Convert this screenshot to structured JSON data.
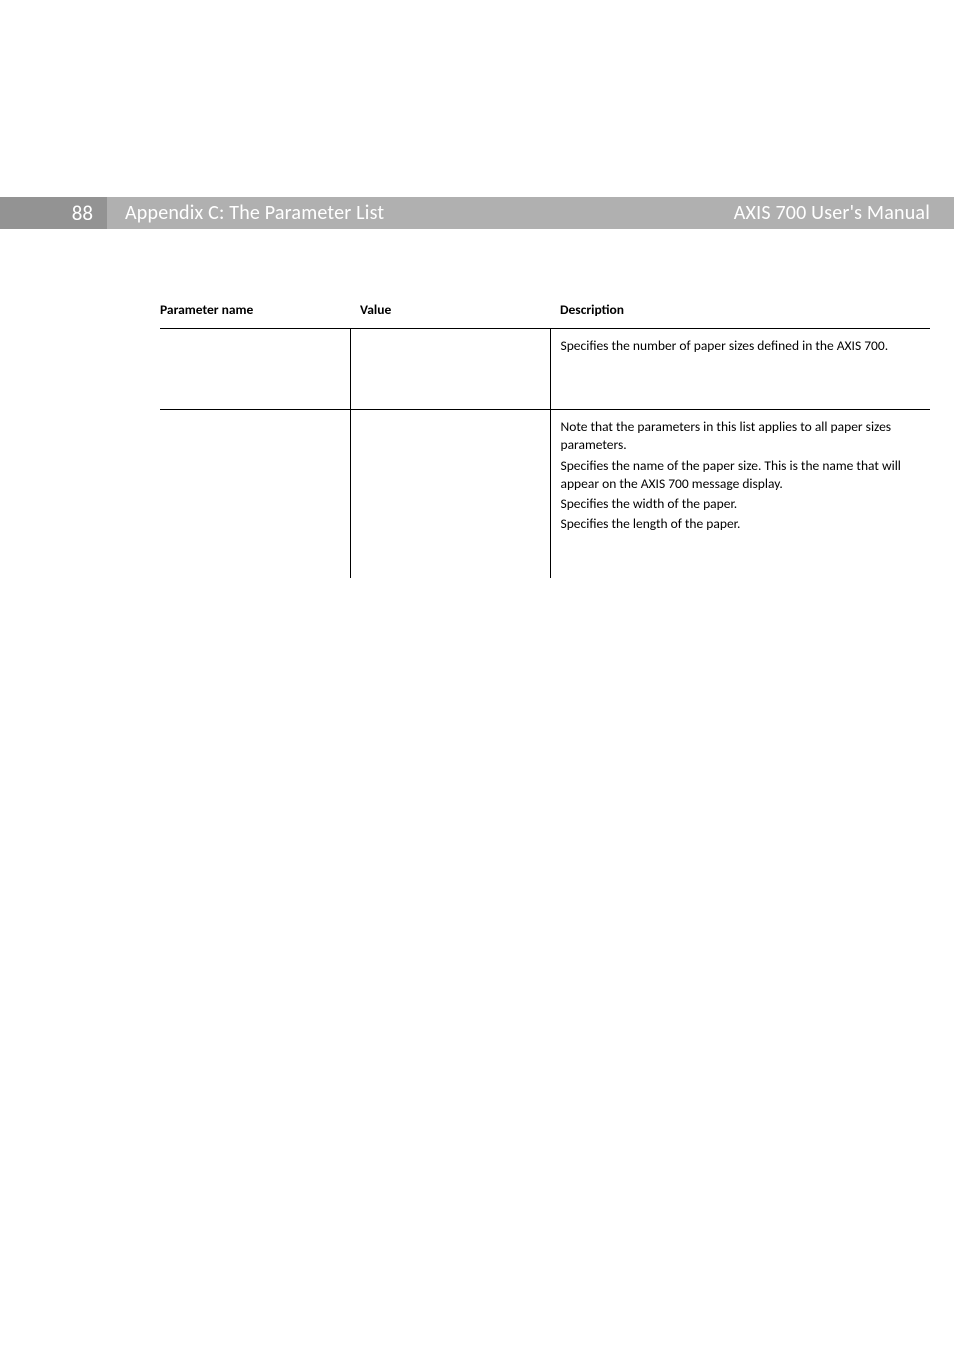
{
  "header": {
    "page_number": "88",
    "appendix_title": "Appendix C: The Parameter List",
    "manual_title": "AXIS 700 User's Manual"
  },
  "table": {
    "headers": {
      "parameter_name": "Parameter name",
      "value": "Value",
      "description": "Description"
    },
    "row1": {
      "parameter_name": "",
      "value": "",
      "description": "Specifies the number of paper sizes defined in the AXIS 700."
    },
    "row2": {
      "parameter_name": "",
      "value": "",
      "d1": "Note that the parameters in this list applies to all paper sizes parameters.",
      "d2": "Specifies the name of the paper size. This is the name that will appear on the AXIS 700 message display.",
      "d3": "Specifies the width of the paper.",
      "d4": "Specifies the length of the paper."
    }
  }
}
